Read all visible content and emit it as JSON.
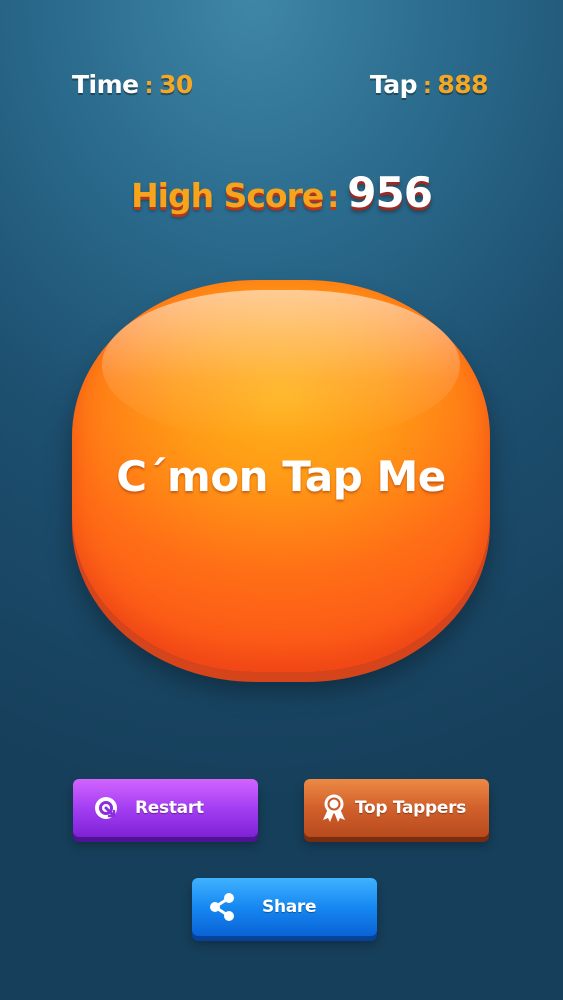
{
  "hud": {
    "time_label": "Time",
    "time_value": "30",
    "tap_label": "Tap",
    "tap_value": "888",
    "separator": ":"
  },
  "high_score": {
    "label": "High Score",
    "separator": ":",
    "value": "956"
  },
  "tap_button": {
    "label": "C´mon Tap Me"
  },
  "buttons": {
    "restart": {
      "label": "Restart",
      "icon": "restart-icon",
      "color": "#a43ef2"
    },
    "top_tappers": {
      "label": "Top Tappers",
      "icon": "award-ribbon-icon",
      "color": "#d2602c"
    },
    "share": {
      "label": "Share",
      "icon": "share-icon",
      "color": "#1688f2"
    }
  },
  "colors": {
    "accent": "#f5a623",
    "tap_button": "#ff8a16",
    "background": "#1d4f6f"
  }
}
